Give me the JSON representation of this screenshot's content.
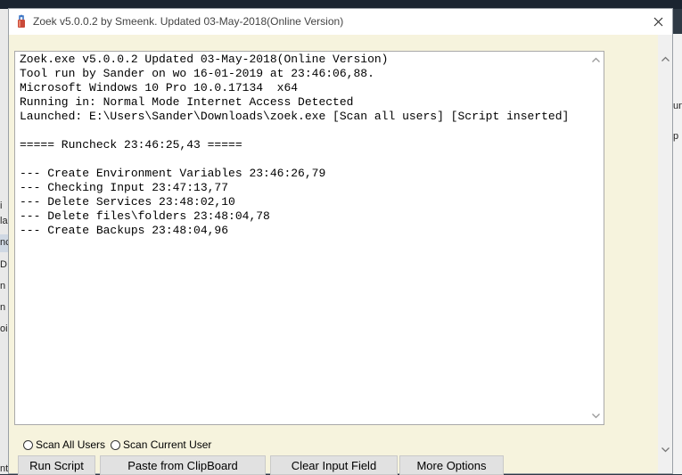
{
  "window": {
    "title": "Zoek v5.0.0.2 by Smeenk. Updated 03-May-2018(Online Version)"
  },
  "log": {
    "lines": [
      "Zoek.exe v5.0.0.2 Updated 03-May-2018(Online Version)",
      "Tool run by Sander on wo 16-01-2019 at 23:46:06,88.",
      "Microsoft Windows 10 Pro 10.0.17134  x64",
      "Running in: Normal Mode Internet Access Detected",
      "Launched: E:\\Users\\Sander\\Downloads\\zoek.exe [Scan all users] [Script inserted]",
      "",
      "===== Runcheck 23:46:25,43 =====",
      "",
      "--- Create Environment Variables 23:46:26,79",
      "--- Checking Input 23:47:13,77",
      "--- Delete Services 23:48:02,10",
      "--- Delete files\\folders 23:48:04,78",
      "--- Create Backups 23:48:04,96"
    ]
  },
  "options": {
    "scan_all_users": "Scan All Users",
    "scan_current_user": "Scan Current User"
  },
  "buttons": {
    "run_script": "Run Script",
    "paste_clipboard": "Paste from ClipBoard",
    "clear_input": "Clear Input Field",
    "more_options": "More Options"
  },
  "background": {
    "left_fragments": [
      "i",
      "la",
      "nc",
      "D",
      "n",
      "n",
      "oi",
      "nten"
    ],
    "right_fragments": [
      "un",
      "p"
    ]
  },
  "colors": {
    "client_background": "#f6f3dd",
    "button_face": "#e1e1e1",
    "title_text": "#444444"
  },
  "icons": {
    "app": "zoek-app-icon",
    "close": "close-icon",
    "scroll_up": "chevron-up-icon",
    "scroll_down": "chevron-down-icon"
  }
}
